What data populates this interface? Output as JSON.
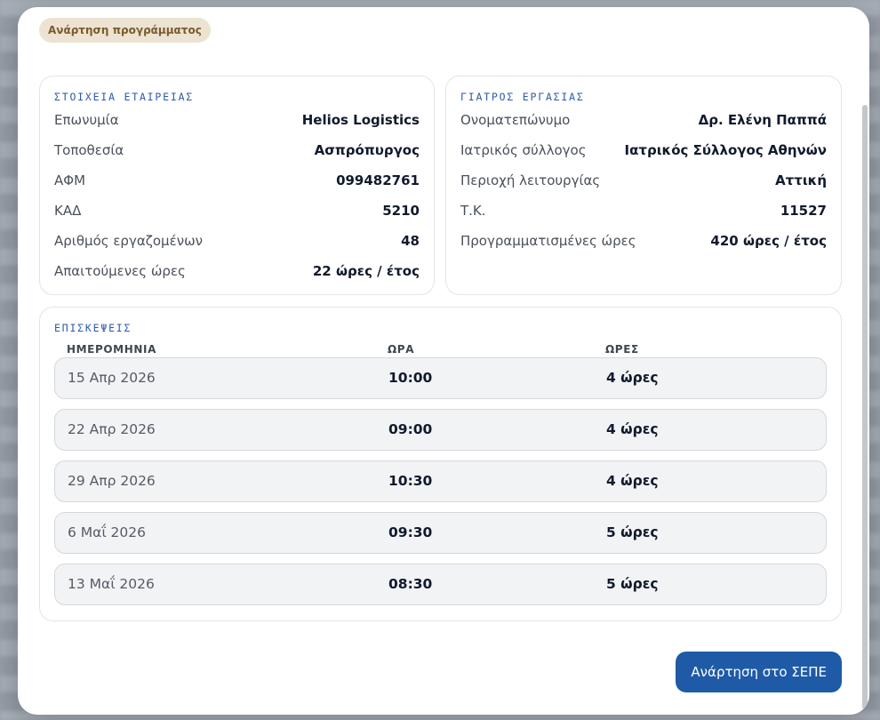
{
  "colors": {
    "accent": "#1f5aa6",
    "section_title": "#2b5aa8",
    "badge_bg": "#ede3d3",
    "badge_text": "#7a5a2c"
  },
  "badge": {
    "label": "Ανάρτηση προγράμματος"
  },
  "company": {
    "title": "ΣΤΟΙΧΕΙΑ ΕΤΑΙΡΕΙΑΣ",
    "rows": [
      {
        "label": "Επωνυμία",
        "value": "Helios Logistics"
      },
      {
        "label": "Τοποθεσία",
        "value": "Ασπρόπυργος"
      },
      {
        "label": "ΑΦΜ",
        "value": "099482761"
      },
      {
        "label": "ΚΑΔ",
        "value": "5210"
      },
      {
        "label": "Αριθμός εργαζομένων",
        "value": "48"
      },
      {
        "label": "Απαιτούμενες ώρες",
        "value": "22 ώρες / έτος"
      }
    ]
  },
  "doctor": {
    "title": "ΓΙΑΤΡΟΣ ΕΡΓΑΣΙΑΣ",
    "rows": [
      {
        "label": "Ονοματεπώνυμο",
        "value": "Δρ. Ελένη Παππά"
      },
      {
        "label": "Ιατρικός σύλλογος",
        "value": "Ιατρικός Σύλλογος Αθηνών"
      },
      {
        "label": "Περιοχή λειτουργίας",
        "value": "Αττική"
      },
      {
        "label": "Τ.Κ.",
        "value": "11527"
      },
      {
        "label": "Προγραμματισμένες ώρες",
        "value": "420 ώρες / έτος"
      }
    ]
  },
  "visits": {
    "title": "ΕΠΙΣΚΕΨΕΙΣ",
    "columns": [
      "ΗΜΕΡΟΜΗΝΙΑ",
      "ΩΡΑ",
      "ΩΡΕΣ"
    ],
    "rows": [
      {
        "date": "15 Απρ 2026",
        "time": "10:00",
        "hours": "4 ώρες"
      },
      {
        "date": "22 Απρ 2026",
        "time": "09:00",
        "hours": "4 ώρες"
      },
      {
        "date": "29 Απρ 2026",
        "time": "10:30",
        "hours": "4 ώρες"
      },
      {
        "date": "6 Μαΐ 2026",
        "time": "09:30",
        "hours": "5 ώρες"
      },
      {
        "date": "13 Μαΐ 2026",
        "time": "08:30",
        "hours": "5 ώρες"
      }
    ]
  },
  "actions": {
    "submit_label": "Ανάρτηση στο ΣΕΠΕ"
  }
}
